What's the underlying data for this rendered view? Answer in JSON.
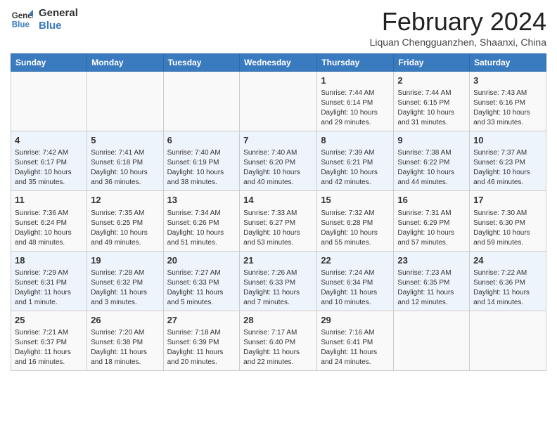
{
  "logo": {
    "line1": "General",
    "line2": "Blue"
  },
  "title": "February 2024",
  "location": "Liquan Chengguanzhen, Shaanxi, China",
  "days_of_week": [
    "Sunday",
    "Monday",
    "Tuesday",
    "Wednesday",
    "Thursday",
    "Friday",
    "Saturday"
  ],
  "weeks": [
    [
      {
        "day": "",
        "info": ""
      },
      {
        "day": "",
        "info": ""
      },
      {
        "day": "",
        "info": ""
      },
      {
        "day": "",
        "info": ""
      },
      {
        "day": "1",
        "info": "Sunrise: 7:44 AM\nSunset: 6:14 PM\nDaylight: 10 hours and 29 minutes."
      },
      {
        "day": "2",
        "info": "Sunrise: 7:44 AM\nSunset: 6:15 PM\nDaylight: 10 hours and 31 minutes."
      },
      {
        "day": "3",
        "info": "Sunrise: 7:43 AM\nSunset: 6:16 PM\nDaylight: 10 hours and 33 minutes."
      }
    ],
    [
      {
        "day": "4",
        "info": "Sunrise: 7:42 AM\nSunset: 6:17 PM\nDaylight: 10 hours and 35 minutes."
      },
      {
        "day": "5",
        "info": "Sunrise: 7:41 AM\nSunset: 6:18 PM\nDaylight: 10 hours and 36 minutes."
      },
      {
        "day": "6",
        "info": "Sunrise: 7:40 AM\nSunset: 6:19 PM\nDaylight: 10 hours and 38 minutes."
      },
      {
        "day": "7",
        "info": "Sunrise: 7:40 AM\nSunset: 6:20 PM\nDaylight: 10 hours and 40 minutes."
      },
      {
        "day": "8",
        "info": "Sunrise: 7:39 AM\nSunset: 6:21 PM\nDaylight: 10 hours and 42 minutes."
      },
      {
        "day": "9",
        "info": "Sunrise: 7:38 AM\nSunset: 6:22 PM\nDaylight: 10 hours and 44 minutes."
      },
      {
        "day": "10",
        "info": "Sunrise: 7:37 AM\nSunset: 6:23 PM\nDaylight: 10 hours and 46 minutes."
      }
    ],
    [
      {
        "day": "11",
        "info": "Sunrise: 7:36 AM\nSunset: 6:24 PM\nDaylight: 10 hours and 48 minutes."
      },
      {
        "day": "12",
        "info": "Sunrise: 7:35 AM\nSunset: 6:25 PM\nDaylight: 10 hours and 49 minutes."
      },
      {
        "day": "13",
        "info": "Sunrise: 7:34 AM\nSunset: 6:26 PM\nDaylight: 10 hours and 51 minutes."
      },
      {
        "day": "14",
        "info": "Sunrise: 7:33 AM\nSunset: 6:27 PM\nDaylight: 10 hours and 53 minutes."
      },
      {
        "day": "15",
        "info": "Sunrise: 7:32 AM\nSunset: 6:28 PM\nDaylight: 10 hours and 55 minutes."
      },
      {
        "day": "16",
        "info": "Sunrise: 7:31 AM\nSunset: 6:29 PM\nDaylight: 10 hours and 57 minutes."
      },
      {
        "day": "17",
        "info": "Sunrise: 7:30 AM\nSunset: 6:30 PM\nDaylight: 10 hours and 59 minutes."
      }
    ],
    [
      {
        "day": "18",
        "info": "Sunrise: 7:29 AM\nSunset: 6:31 PM\nDaylight: 11 hours and 1 minute."
      },
      {
        "day": "19",
        "info": "Sunrise: 7:28 AM\nSunset: 6:32 PM\nDaylight: 11 hours and 3 minutes."
      },
      {
        "day": "20",
        "info": "Sunrise: 7:27 AM\nSunset: 6:33 PM\nDaylight: 11 hours and 5 minutes."
      },
      {
        "day": "21",
        "info": "Sunrise: 7:26 AM\nSunset: 6:33 PM\nDaylight: 11 hours and 7 minutes."
      },
      {
        "day": "22",
        "info": "Sunrise: 7:24 AM\nSunset: 6:34 PM\nDaylight: 11 hours and 10 minutes."
      },
      {
        "day": "23",
        "info": "Sunrise: 7:23 AM\nSunset: 6:35 PM\nDaylight: 11 hours and 12 minutes."
      },
      {
        "day": "24",
        "info": "Sunrise: 7:22 AM\nSunset: 6:36 PM\nDaylight: 11 hours and 14 minutes."
      }
    ],
    [
      {
        "day": "25",
        "info": "Sunrise: 7:21 AM\nSunset: 6:37 PM\nDaylight: 11 hours and 16 minutes."
      },
      {
        "day": "26",
        "info": "Sunrise: 7:20 AM\nSunset: 6:38 PM\nDaylight: 11 hours and 18 minutes."
      },
      {
        "day": "27",
        "info": "Sunrise: 7:18 AM\nSunset: 6:39 PM\nDaylight: 11 hours and 20 minutes."
      },
      {
        "day": "28",
        "info": "Sunrise: 7:17 AM\nSunset: 6:40 PM\nDaylight: 11 hours and 22 minutes."
      },
      {
        "day": "29",
        "info": "Sunrise: 7:16 AM\nSunset: 6:41 PM\nDaylight: 11 hours and 24 minutes."
      },
      {
        "day": "",
        "info": ""
      },
      {
        "day": "",
        "info": ""
      }
    ]
  ]
}
